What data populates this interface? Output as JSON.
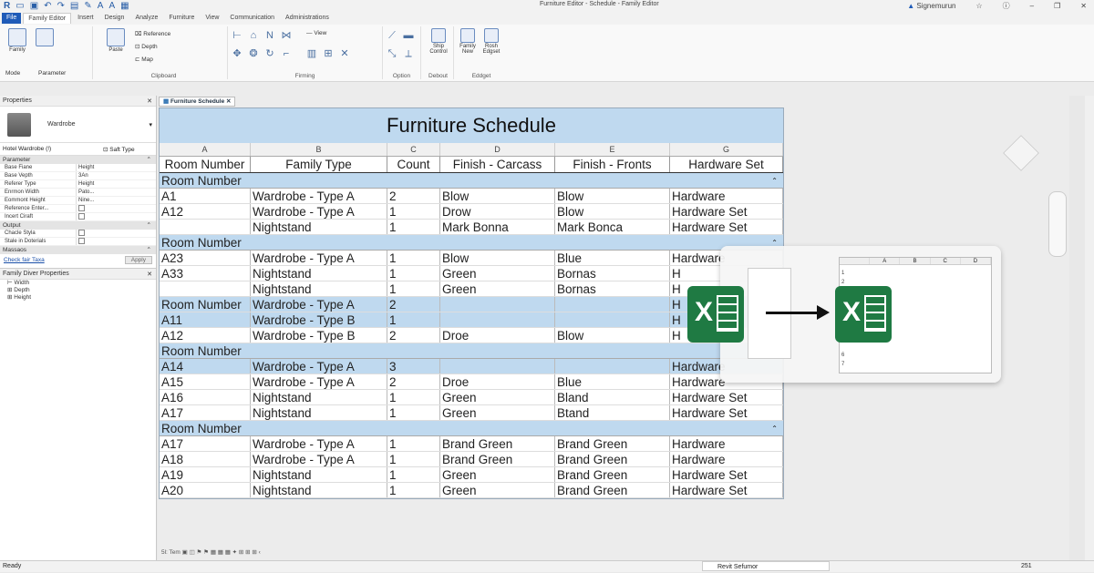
{
  "title_bar": {
    "title": "Furniture Editor - Schedule - Family Editor",
    "user": "Signemurun"
  },
  "ribbon_tabs": [
    "File",
    "Family Editor",
    "Insert",
    "Design",
    "Analyze",
    "Furniture",
    "View",
    "Communication",
    "Administrations"
  ],
  "ribbon": {
    "mode_label": "Mode",
    "parameter_label": "Parameter",
    "family_label": "Family",
    "paste_label": "Paste",
    "clipboard": {
      "reference": "Reference",
      "depth": "Depth",
      "map": "Map",
      "group_label": "Clipboard"
    },
    "view_label": "View",
    "firming_label": "Firming",
    "option_label": "Option",
    "ship_control": "Ship Control",
    "debout_label": "Debout",
    "family_new": "Family New",
    "rosh_edgset": "Rosh Edgset",
    "edgset_label": "Eddget"
  },
  "properties": {
    "header": "Properties",
    "type_name": "Wardrobe",
    "type_selector": "Hotel Wardrobe (!)",
    "edit_type": "Saft Type",
    "sections": [
      {
        "name": "Parameter",
        "rows": [
          {
            "k": "Base Fiane",
            "v": "Height"
          },
          {
            "k": "Base Vepth",
            "v": "3An"
          },
          {
            "k": "Referer Type",
            "v": "Height"
          },
          {
            "k": "Enrmon Width",
            "v": "Pato..."
          },
          {
            "k": "Eommont Height",
            "v": "Nine..."
          },
          {
            "k": "Reference Enter...",
            "v": ""
          },
          {
            "k": "Incert Ciraft",
            "v": ""
          }
        ]
      },
      {
        "name": "Output",
        "rows": [
          {
            "k": "Chacle Styla",
            "v": ""
          },
          {
            "k": "Stale in Doterials",
            "v": ""
          }
        ]
      },
      {
        "name": "Massaos",
        "rows": []
      }
    ],
    "link": "Check fair Taxa",
    "apply": "Apply",
    "browser_title": "Family Diver Properties",
    "browser_items": [
      "Width",
      "Depth",
      "Height"
    ]
  },
  "doc_tab": "Furniture Schedule",
  "schedule": {
    "title": "Furniture Schedule",
    "col_letters": [
      "A",
      "B",
      "C",
      "D",
      "E",
      "G"
    ],
    "headers": [
      "Room Number",
      "Family Type",
      "Count",
      "Finish - Carcass",
      "Finish - Fronts",
      "Hardware Set"
    ],
    "group_label": "Room Number",
    "g1": [
      [
        "A1",
        "Wardrobe - Type A",
        "2",
        "Blow",
        "Blow",
        "Hardware"
      ],
      [
        "A12",
        "Wardrobe - Type A",
        "1",
        "Drow",
        "Blow",
        "Hardware Set"
      ],
      [
        "",
        "Nightstand",
        "1",
        "Mark Bonna",
        "Mark Bonca",
        "Hardware Set"
      ]
    ],
    "g2": [
      [
        "A23",
        "Wardrobe - Type A",
        "1",
        "Blow",
        "Blue",
        "Hardware"
      ],
      [
        "A33",
        "Nightstand",
        "1",
        "Green",
        "Bornas",
        "H"
      ],
      [
        "",
        "Nightstand",
        "1",
        "Green",
        "Bornas",
        "H"
      ]
    ],
    "g3": [
      [
        "Room Number",
        "Wardrobe - Type A",
        "2",
        "",
        "",
        "H"
      ],
      [
        "A11",
        "Wardrobe - Type B",
        "1",
        "",
        "",
        "H"
      ],
      [
        "A12",
        "Wardrobe - Type B",
        "2",
        "Droe",
        "Blow",
        "H"
      ]
    ],
    "g4": [
      [
        "A14",
        "Wardrobe - Type A",
        "3",
        "",
        "",
        "Hardware"
      ],
      [
        "A15",
        "Wardrobe - Type A",
        "2",
        "Droe",
        "Blue",
        "Hardware"
      ],
      [
        "A16",
        "Nightstand",
        "1",
        "Green",
        "Bland",
        "Hardware Set"
      ],
      [
        "A17",
        "Nightstand",
        "1",
        "Green",
        "Btand",
        "Hardware Set"
      ]
    ],
    "g5": [
      [
        "A17",
        "Wardrobe - Type A",
        "1",
        "Brand Green",
        "Brand Green",
        "Hardware"
      ],
      [
        "A18",
        "Wardrobe - Type A",
        "1",
        "Brand Green",
        "Brand Green",
        "Hardware"
      ],
      [
        "A19",
        "Nightstand",
        "1",
        "Green",
        "Brand Green",
        "Hardware Set"
      ],
      [
        "A20",
        "Nightstand",
        "1",
        "Green",
        "Brand Green",
        "Hardware Set"
      ]
    ]
  },
  "overlay": {
    "sheet_cols": [
      "A",
      "B",
      "C",
      "D"
    ],
    "sheet_rows": [
      "1",
      "2",
      "6",
      "7"
    ]
  },
  "sheet_tabs": "5l: Tem",
  "status": {
    "left": "Ready",
    "view_select": "Revit Sefumor",
    "count": "251"
  },
  "colors": {
    "accent": "#1f5bb8",
    "schedule_header": "#bfd9ef",
    "excel": "#1f7a43"
  }
}
